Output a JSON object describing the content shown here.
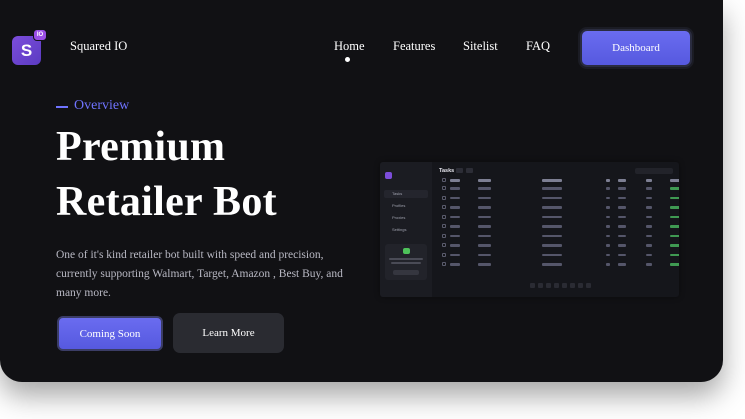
{
  "brand": {
    "logo_letter": "S",
    "badge": "IO",
    "name": "Squared IO"
  },
  "nav": {
    "links": [
      "Home",
      "Features",
      "Sitelist",
      "FAQ"
    ],
    "active": "Home",
    "cta": "Dashboard"
  },
  "hero": {
    "eyebrow": "Overview",
    "headline_line1": "Premium",
    "headline_line2": "Retailer Bot",
    "description": "One of it's kind retailer bot built with speed and precision, currently supporting Walmart, Target, Amazon , Best Buy, and many more.",
    "primary_button": "Coming Soon",
    "secondary_button": "Learn More"
  },
  "preview": {
    "title": "Tasks",
    "sidebar_items": [
      "Tasks",
      "Profiles",
      "Proxies",
      "Settings"
    ]
  },
  "colors": {
    "accent": "#5d60e6",
    "background": "#111114",
    "overview": "#6f73ff"
  }
}
